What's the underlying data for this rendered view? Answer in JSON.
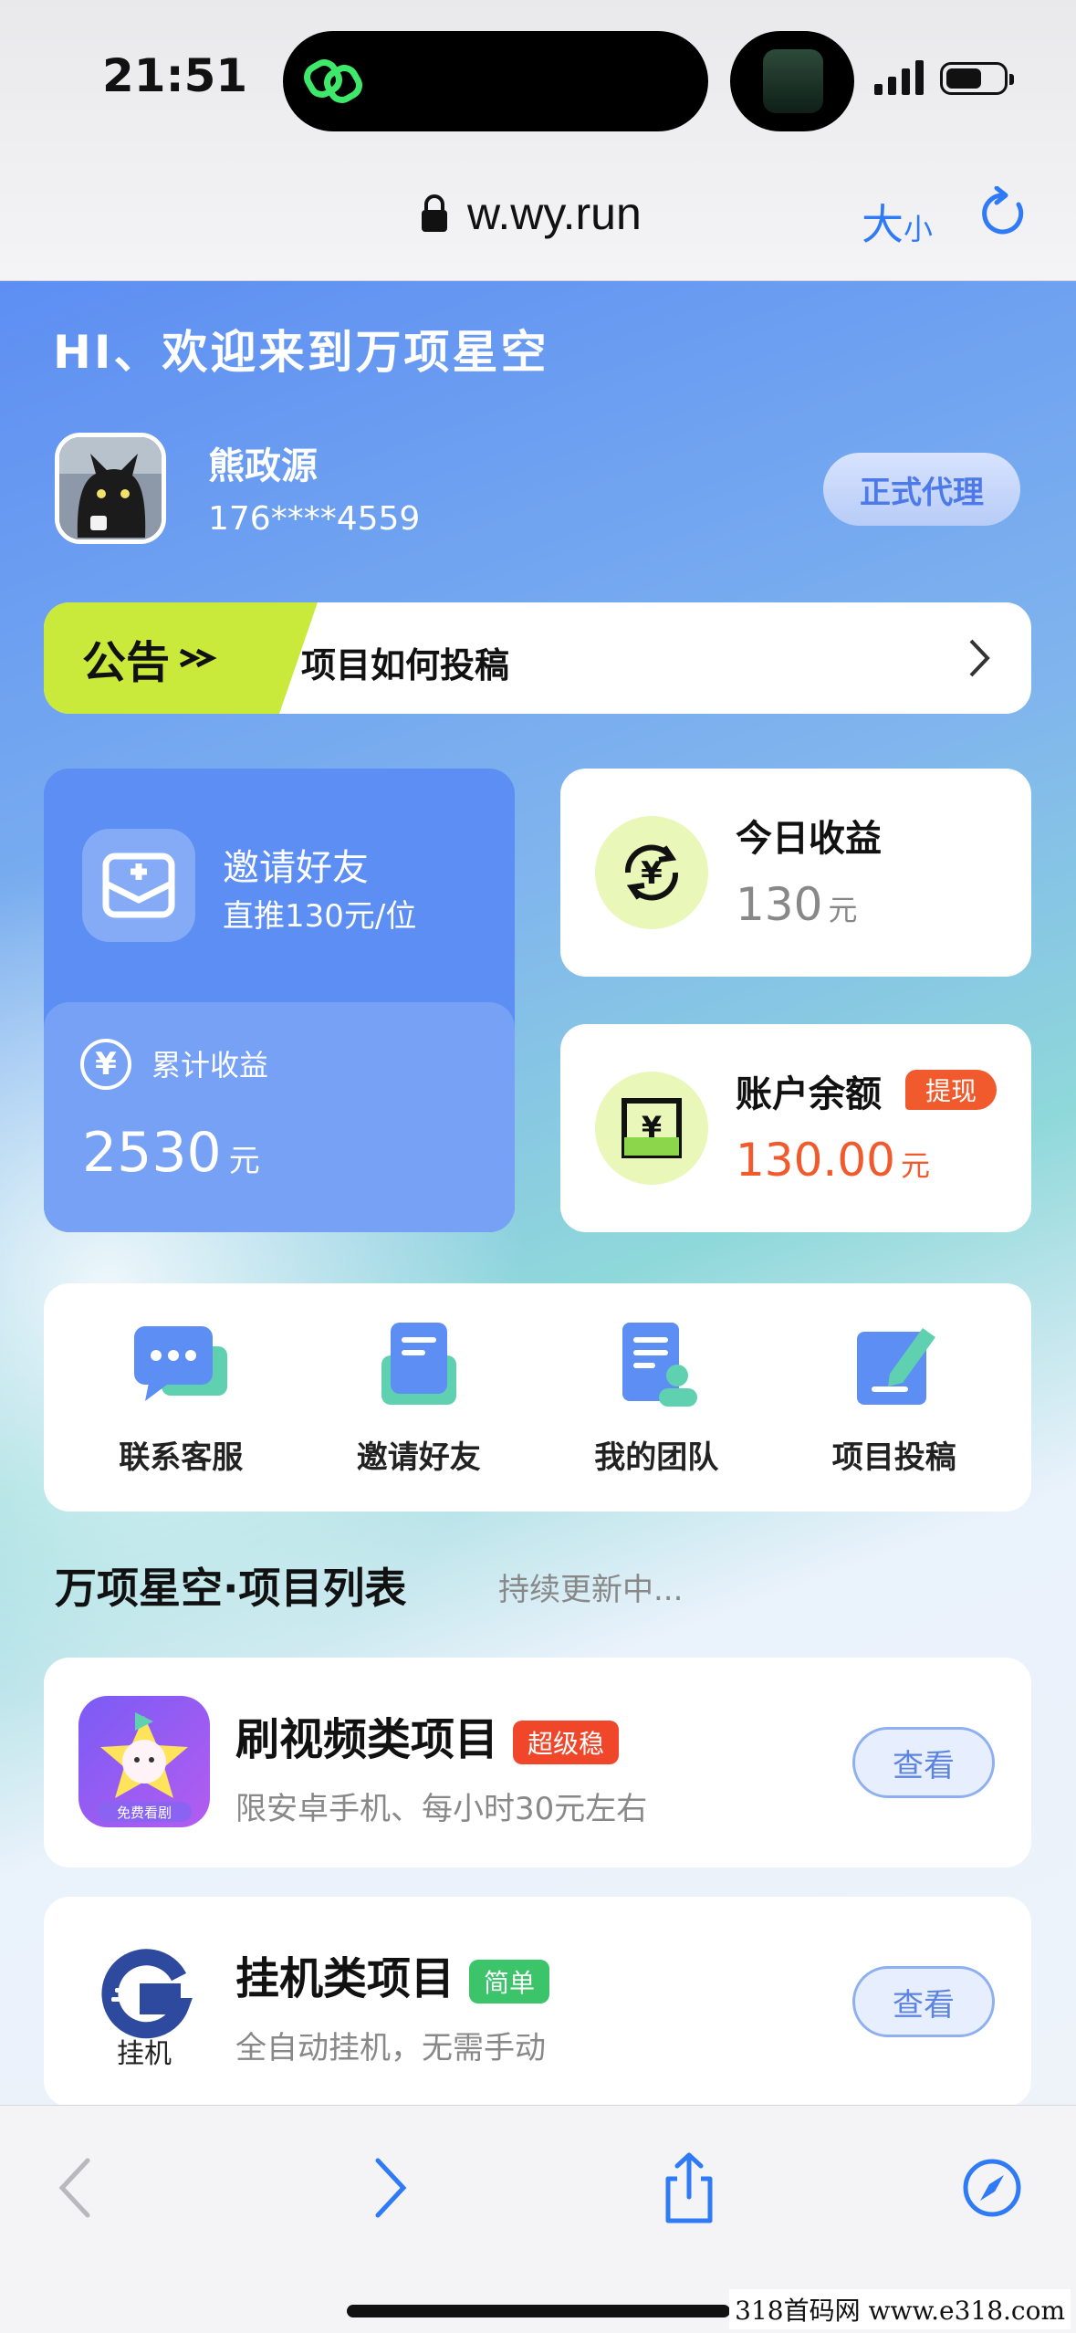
{
  "status_bar": {
    "time": "21:51"
  },
  "address_bar": {
    "url": "w.wy.run",
    "text_size_big": "大",
    "text_size_small": "小"
  },
  "header": {
    "welcome": "HI、欢迎来到万项星空",
    "username": "熊政源",
    "phone": "176****4559",
    "role_button": "正式代理"
  },
  "notice": {
    "tag": "公告",
    "text": "项目如何投稿"
  },
  "invite_card": {
    "title": "邀请好友",
    "subtitle": "直推130元/位",
    "total_label": "累计收益",
    "total_value": "2530",
    "total_unit": "元"
  },
  "today_card": {
    "title": "今日收益",
    "value": "130",
    "unit": "元"
  },
  "balance_card": {
    "title": "账户余额",
    "badge": "提现",
    "value": "130.00",
    "unit": "元"
  },
  "quick_nav": [
    {
      "label": "联系客服",
      "icon": "chat-icon"
    },
    {
      "label": "邀请好友",
      "icon": "invite-icon"
    },
    {
      "label": "我的团队",
      "icon": "team-icon"
    },
    {
      "label": "项目投稿",
      "icon": "edit-icon"
    }
  ],
  "project_list": {
    "title": "万项星空·项目列表",
    "subtitle": "持续更新中...",
    "items": [
      {
        "title": "刷视频类项目",
        "badge": "超级稳",
        "badge_color": "#f0462a",
        "desc": "限安卓手机、每小时30元左右",
        "button": "查看",
        "logo_caption": "免费看剧"
      },
      {
        "title": "挂机类项目",
        "badge": "简单",
        "badge_color": "#3cc46a",
        "desc": "全自动挂机，无需手动",
        "button": "查看",
        "logo_caption": "挂机"
      }
    ]
  },
  "watermark": "318首码网 www.e318.com",
  "colors": {
    "accent": "#5d8ef3",
    "lime": "#c9ea3a",
    "orange": "#f05a2c"
  }
}
